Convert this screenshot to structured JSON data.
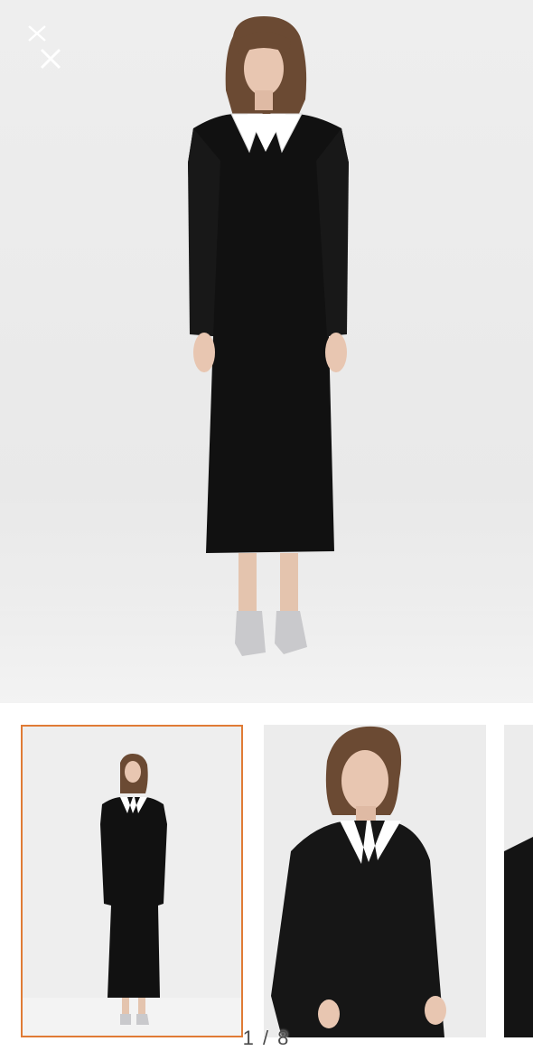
{
  "viewer": {
    "close_icon": "close-icon",
    "counter": "1 / 8",
    "current_index": 1,
    "total_images": 8
  },
  "thumbnails": [
    {
      "name": "thumbnail-1",
      "selected": true
    },
    {
      "name": "thumbnail-2",
      "selected": false
    },
    {
      "name": "thumbnail-3",
      "selected": false
    }
  ],
  "colors": {
    "selected_border": "#e07b35",
    "backdrop": "#eeeeee",
    "dress": "#111111",
    "collar": "#ffffff"
  }
}
